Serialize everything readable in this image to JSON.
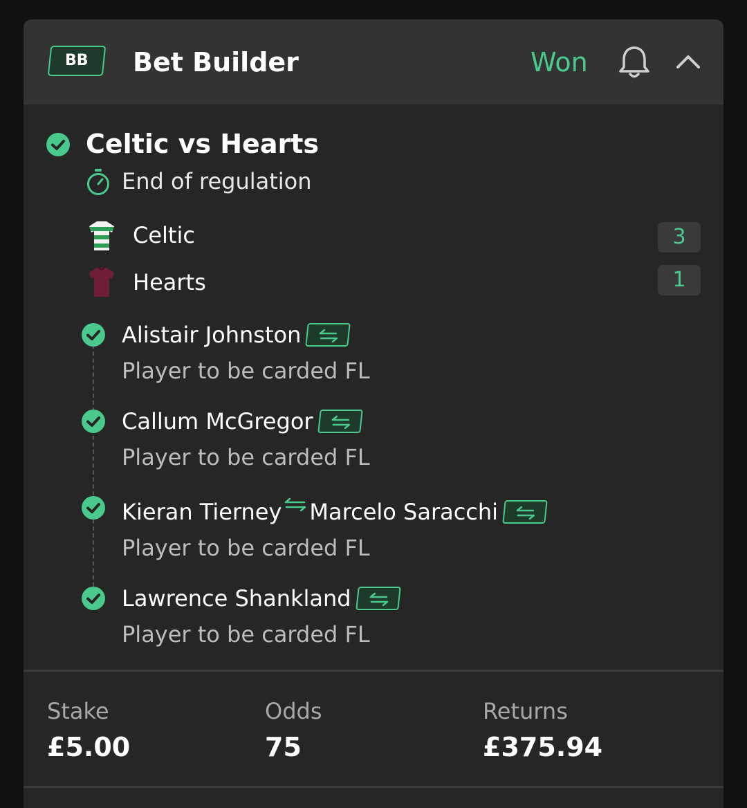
{
  "header": {
    "badge": "BB",
    "title": "Bet Builder",
    "status": "Won"
  },
  "event": {
    "title": "Celtic vs Hearts",
    "period": "End of regulation",
    "teams": [
      {
        "name": "Celtic",
        "score": "3"
      },
      {
        "name": "Hearts",
        "score": "1"
      }
    ]
  },
  "selections": [
    {
      "player": "Alistair Johnston",
      "market": "Player to be carded FL"
    },
    {
      "player": "Callum McGregor",
      "market": "Player to be carded FL"
    },
    {
      "player_out": "Kieran Tierney",
      "player": "Marcelo Saracchi",
      "market": "Player to be carded FL"
    },
    {
      "player": "Lawrence Shankland",
      "market": "Player to be carded FL"
    }
  ],
  "footer": {
    "stake_label": "Stake",
    "stake_value": "£5.00",
    "odds_label": "Odds",
    "odds_value": "75",
    "returns_label": "Returns",
    "returns_value": "£375.94"
  },
  "colors": {
    "accent": "#4ac98c",
    "card": "#262626",
    "header": "#333333",
    "background": "#111111"
  },
  "icons": [
    "check-circle-icon",
    "stopwatch-icon",
    "bell-icon",
    "chevron-up-icon",
    "swap-icon",
    "jersey-icon"
  ]
}
